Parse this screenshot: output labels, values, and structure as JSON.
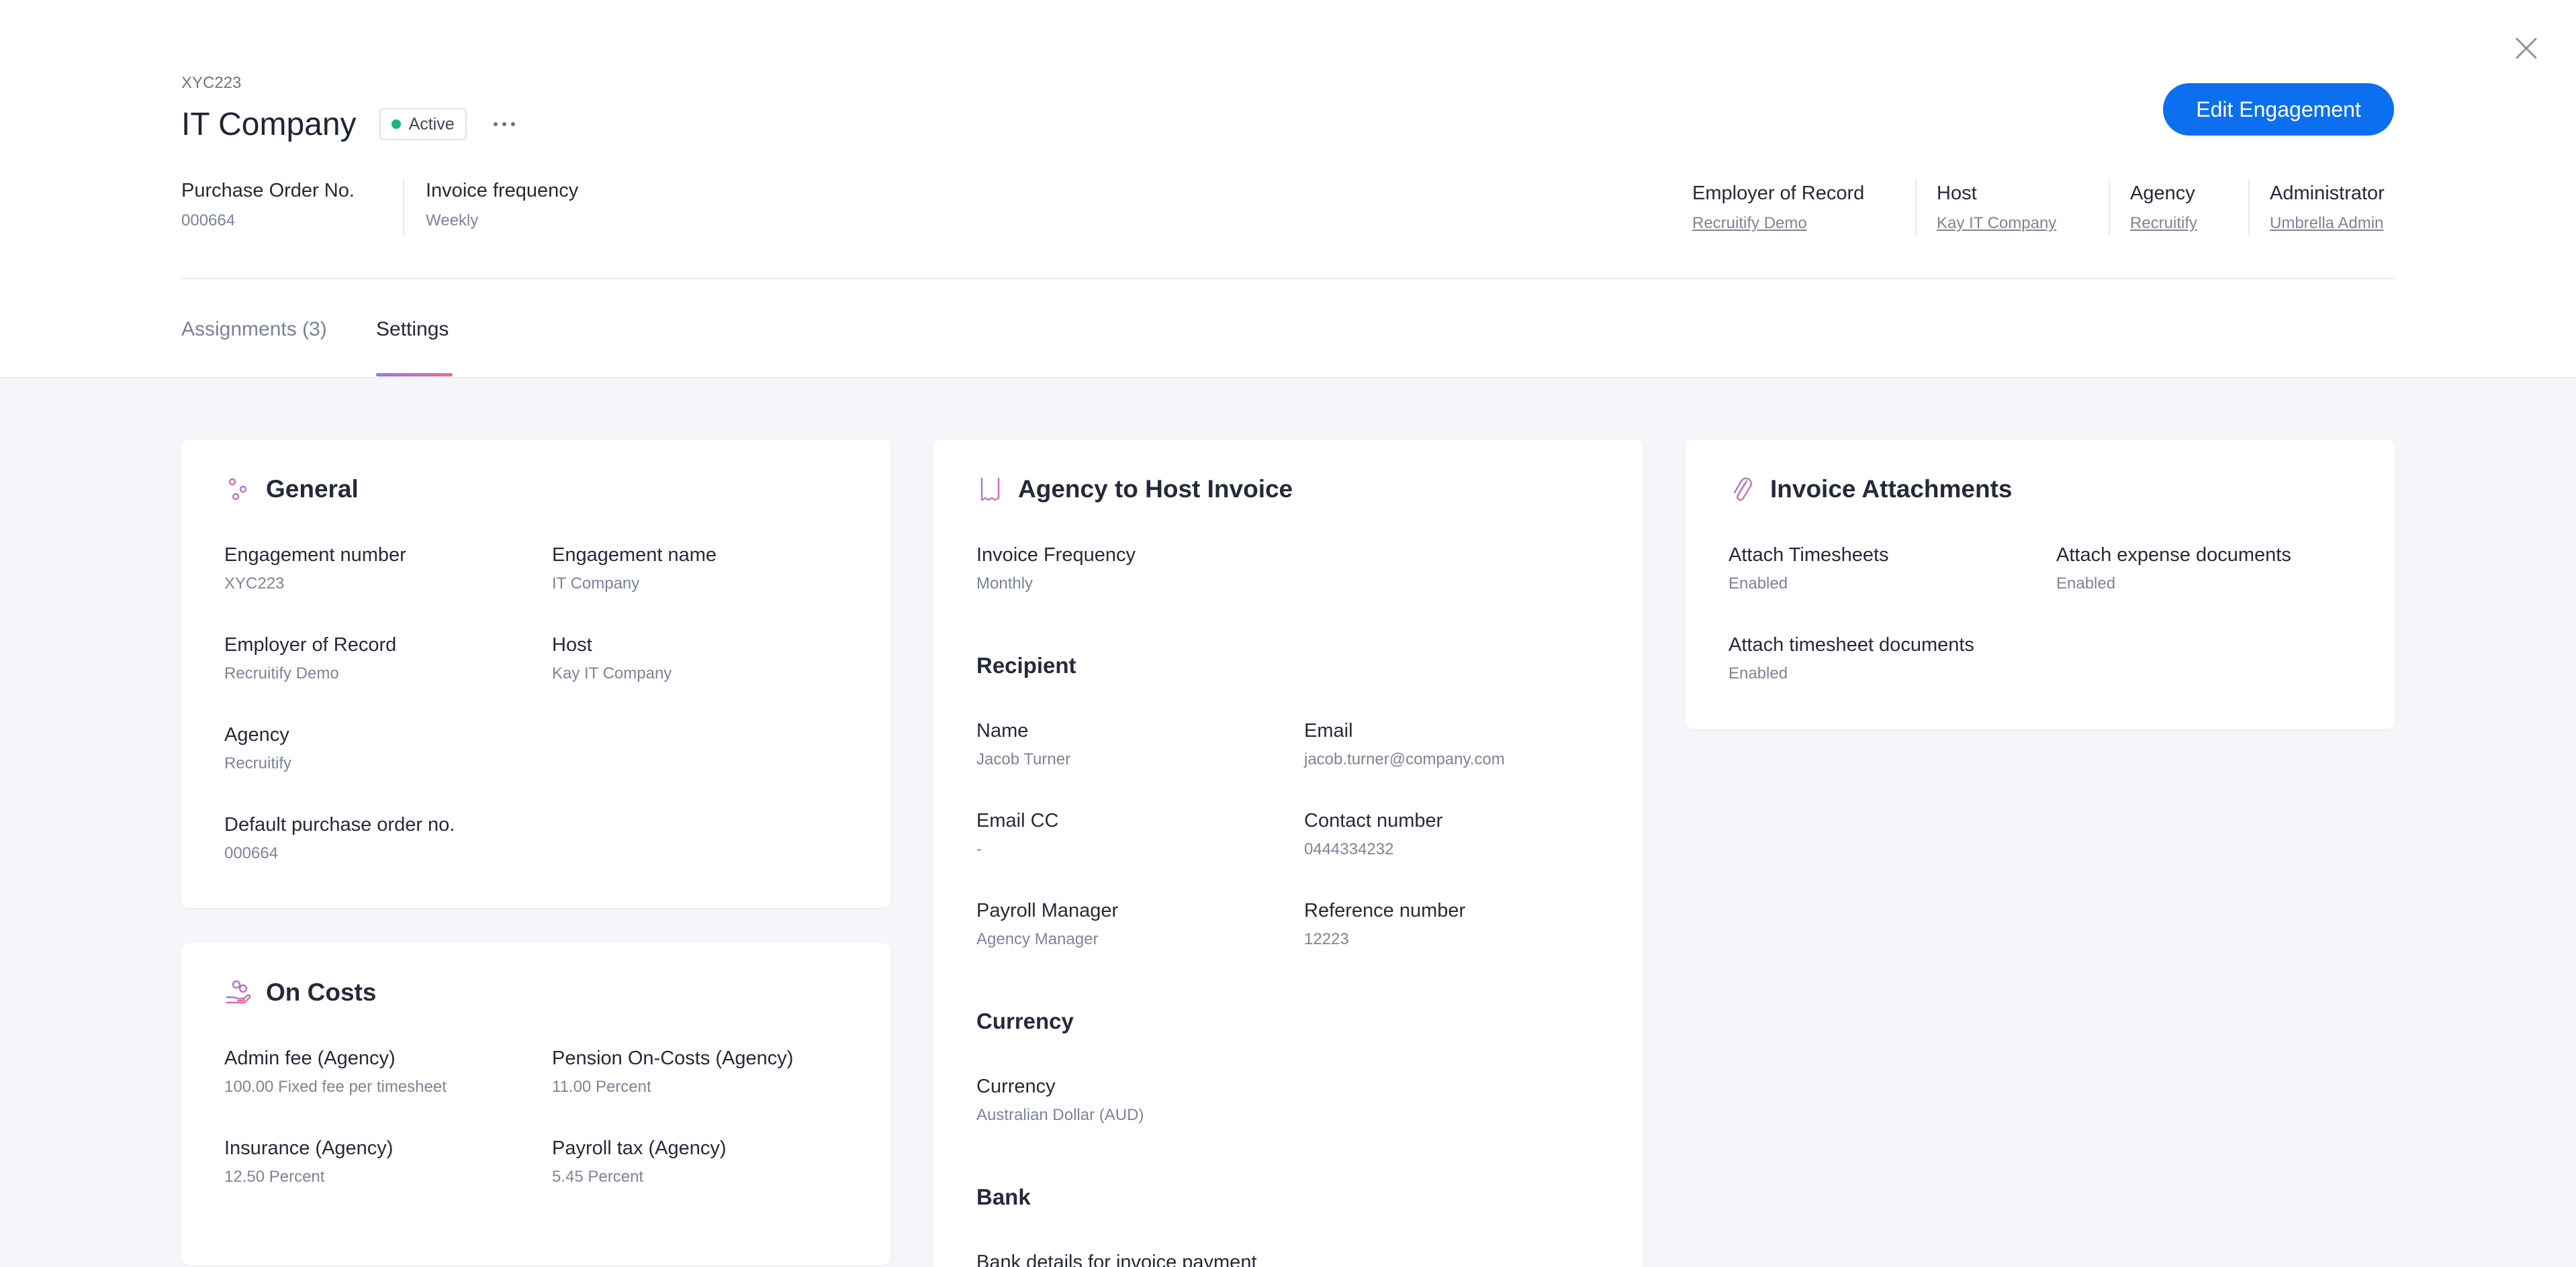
{
  "header": {
    "code": "XYC223",
    "title": "IT Company",
    "status": "Active",
    "edit_button": "Edit Engagement",
    "meta_left": [
      {
        "label": "Purchase Order No.",
        "value": "000664"
      },
      {
        "label": "Invoice frequency",
        "value": "Weekly"
      }
    ],
    "meta_right": [
      {
        "label": "Employer of Record",
        "value": "Recruitify Demo"
      },
      {
        "label": "Host",
        "value": "Kay IT Company"
      },
      {
        "label": "Agency",
        "value": "Recruitify"
      },
      {
        "label": "Administrator",
        "value": "Umbrella Admin"
      }
    ]
  },
  "tabs": [
    {
      "label": "Assignments (3)",
      "active": false
    },
    {
      "label": "Settings",
      "active": true
    }
  ],
  "general": {
    "title": "General",
    "fields": [
      {
        "label": "Engagement number",
        "value": "XYC223"
      },
      {
        "label": "Engagement name",
        "value": "IT Company"
      },
      {
        "label": "Employer of Record",
        "value": "Recruitify Demo"
      },
      {
        "label": "Host",
        "value": "Kay IT Company"
      },
      {
        "label": "Agency",
        "value": "Recruitify"
      },
      {
        "label": "Default purchase order no.",
        "value": "000664"
      }
    ]
  },
  "on_costs": {
    "title": "On Costs",
    "fields": [
      {
        "label": "Admin fee (Agency)",
        "value": "100.00 Fixed fee per timesheet"
      },
      {
        "label": "Pension On-Costs (Agency)",
        "value": "11.00 Percent"
      },
      {
        "label": "Insurance (Agency)",
        "value": "12.50 Percent"
      },
      {
        "label": "Payroll tax (Agency)",
        "value": "5.45 Percent"
      }
    ]
  },
  "invoice": {
    "title": "Agency to Host Invoice",
    "frequency": {
      "label": "Invoice Frequency",
      "value": "Monthly"
    },
    "recipient_title": "Recipient",
    "recipient": [
      {
        "label": "Name",
        "value": "Jacob Turner"
      },
      {
        "label": "Email",
        "value": "jacob.turner@company.com"
      },
      {
        "label": "Email CC",
        "value": "-"
      },
      {
        "label": "Contact number",
        "value": "0444334232"
      },
      {
        "label": "Payroll Manager",
        "value": "Agency Manager"
      },
      {
        "label": "Reference number",
        "value": "12223"
      }
    ],
    "currency_title": "Currency",
    "currency": {
      "label": "Currency",
      "value": "Australian Dollar (AUD)"
    },
    "bank_title": "Bank",
    "bank": {
      "label": "Bank details for invoice payment"
    }
  },
  "attachments": {
    "title": "Invoice Attachments",
    "fields": [
      {
        "label": "Attach Timesheets",
        "value": "Enabled"
      },
      {
        "label": "Attach expense documents",
        "value": "Enabled"
      },
      {
        "label": "Attach timesheet documents",
        "value": "Enabled"
      }
    ]
  },
  "colors": {
    "accent": "#0b6ff0",
    "status_dot": "#1bb47a",
    "icon_gradient_start": "#8b7cf6",
    "icon_gradient_end": "#f06a8e"
  }
}
